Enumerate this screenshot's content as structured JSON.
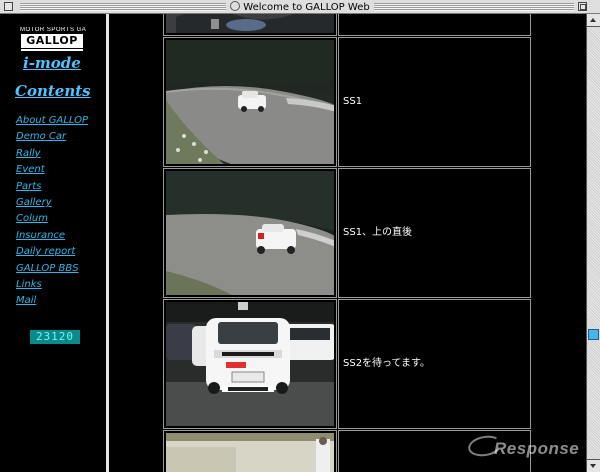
{
  "window": {
    "title": "Welcome to GALLOP Web Site"
  },
  "sidebar": {
    "logo_tagline": "MOTOR SPORTS GALLOP",
    "logo_brand": "GALLOP",
    "imode_label": "i-mode",
    "contents_label": "Contents",
    "nav": [
      "About GALLOP",
      "Demo Car",
      "Rally",
      "Event",
      "Parts",
      "Gallery",
      "Colum",
      "Insurance",
      "Daily report",
      "GALLOP BBS",
      "Links",
      "Mail"
    ],
    "counter": "23120"
  },
  "main": {
    "photos": [
      {
        "name": "top-partial",
        "caption": ""
      },
      {
        "name": "ss1",
        "caption": "SS1"
      },
      {
        "name": "ss1-straight",
        "caption": "SS1、上の直後"
      },
      {
        "name": "ss2-waiting",
        "caption": "SS2を待ってます。"
      },
      {
        "name": "bottom-partial",
        "caption": ""
      }
    ]
  },
  "watermark": "Response",
  "colors": {
    "link": "#4fc3ff",
    "counter_bg": "#0b8a8a",
    "counter_text": "#6ff4ff",
    "scroll_thumb": "#48b4e8"
  }
}
